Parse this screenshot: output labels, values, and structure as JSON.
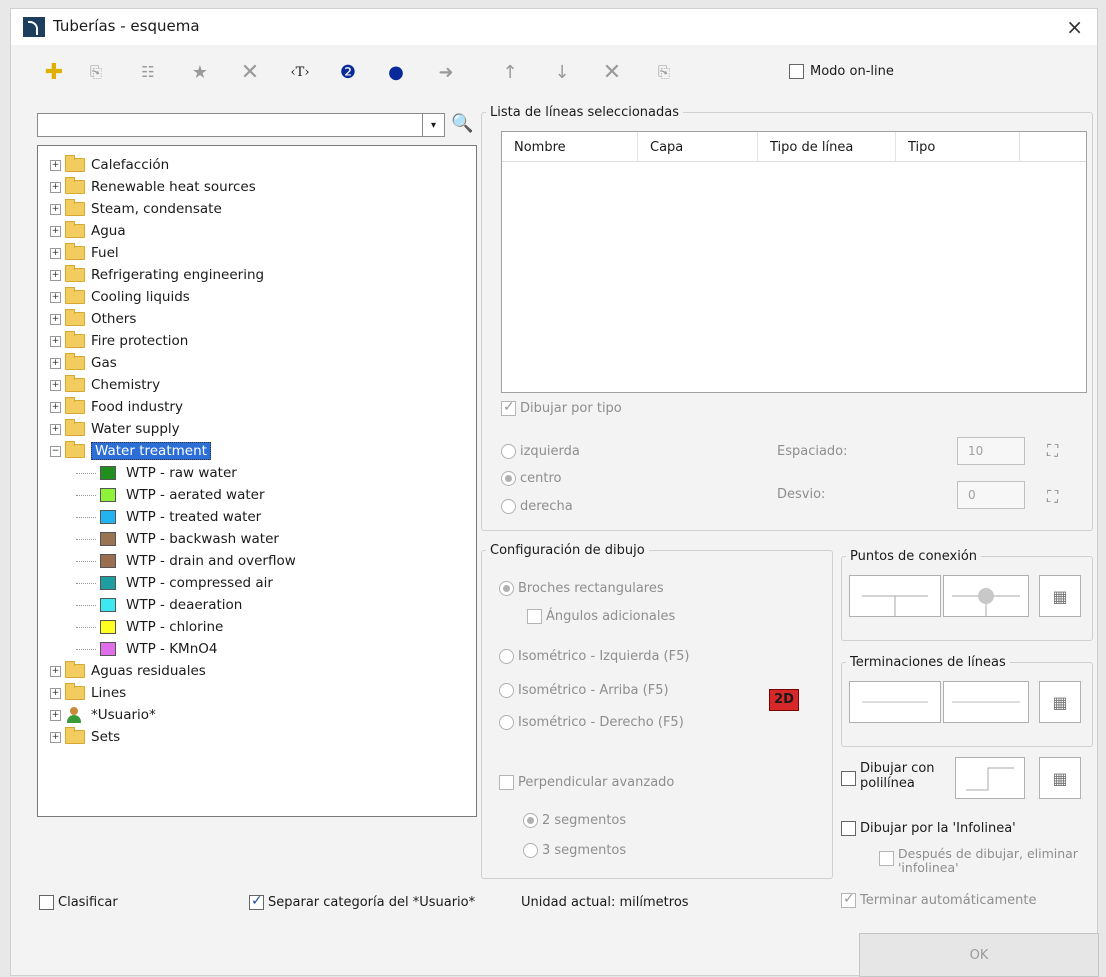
{
  "window": {
    "title": "Tuberías - esquema",
    "close": "×"
  },
  "toolbar": {
    "modo_online": "Modo on-line",
    "icons": [
      "plus-icon",
      "copy-icon",
      "properties-icon",
      "star-icon",
      "delete-icon",
      "text-icon",
      "help-icon",
      "play-icon",
      "arrow-right-icon",
      "arrow-up-icon",
      "arrow-down-icon",
      "delete-icon",
      "copy-icon"
    ]
  },
  "search": {
    "value": "",
    "arrow": "▾"
  },
  "tree": {
    "categories_top": [
      "Calefacción",
      "Renewable heat sources",
      "Steam, condensate",
      "Agua",
      "Fuel",
      "Refrigerating engineering",
      "Cooling liquids",
      "Others",
      "Fire protection",
      "Gas",
      "Chemistry",
      "Food industry",
      "Water supply"
    ],
    "expanded": "Water treatment",
    "children": [
      {
        "label": "WTP - raw water",
        "color": "#1f8f1f"
      },
      {
        "label": "WTP - aerated water",
        "color": "#8ef23a"
      },
      {
        "label": "WTP - treated water",
        "color": "#22b3f0"
      },
      {
        "label": "WTP - backwash water",
        "color": "#9a7452"
      },
      {
        "label": "WTP - drain and overflow",
        "color": "#9a6e4e"
      },
      {
        "label": "WTP - compressed air",
        "color": "#1e9ea0"
      },
      {
        "label": "WTP - deaeration",
        "color": "#3ee8f0"
      },
      {
        "label": "WTP - chlorine",
        "color": "#ffff22"
      },
      {
        "label": "WTP - KMnO4",
        "color": "#e06ee8"
      }
    ],
    "categories_bottom": [
      "Aguas residuales",
      "Lines"
    ],
    "user": "*Usuario*",
    "sets": "Sets"
  },
  "lista": {
    "title": "Lista de líneas seleccionadas",
    "columns": [
      "Nombre",
      "Capa",
      "Tipo de línea",
      "Tipo"
    ],
    "dibujar_por_tipo": "Dibujar por tipo",
    "izquierda": "izquierda",
    "centro": "centro",
    "derecha": "derecha",
    "espaciado_label": "Espaciado:",
    "espaciado_value": "10",
    "desvio_label": "Desvio:",
    "desvio_value": "0"
  },
  "config": {
    "title": "Configuración de dibujo",
    "broches": "Broches rectangulares",
    "angulos": "Ángulos adicionales",
    "iso_izq": "Isométrico - Izquierda (F5)",
    "iso_arriba": "Isométrico - Arriba (F5)",
    "iso_der": "Isométrico - Derecho (F5)",
    "badge": "2D",
    "perpendicular": "Perpendicular avanzado",
    "seg2": "2 segmentos",
    "seg3": "3 segmentos"
  },
  "puntos": {
    "title": "Puntos de conexión"
  },
  "terminaciones": {
    "title": "Terminaciones de líneas"
  },
  "right_opts": {
    "polilinea": "Dibujar con polilínea",
    "infolinea": "Dibujar por la 'Infolinea'",
    "eliminar": "Después de dibujar, eliminar 'infolinea'",
    "terminar": "Terminar automáticamente",
    "ok": "OK"
  },
  "bottom": {
    "clasificar": "Clasificar",
    "separar": "Separar categoría del *Usuario*",
    "unidad": "Unidad actual: milímetros"
  }
}
